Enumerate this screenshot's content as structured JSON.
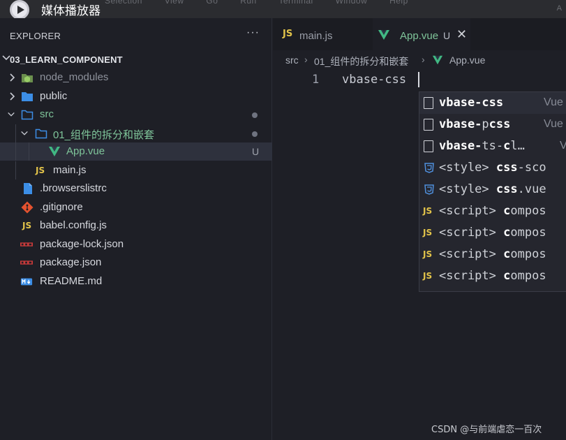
{
  "player": {
    "title": "媒体播放器",
    "ghost_menu": [
      "Selection",
      "View",
      "Go",
      "Run",
      "Terminal",
      "Window",
      "Help"
    ],
    "ghost_right": "A"
  },
  "explorer": {
    "title": "EXPLORER",
    "more": "···",
    "project": "03_LEARN_COMPONENT",
    "items": [
      {
        "label": "node_modules",
        "kind": "folder-node",
        "expanded": false,
        "status": ""
      },
      {
        "label": "public",
        "kind": "folder-blue",
        "expanded": false,
        "status": ""
      },
      {
        "label": "src",
        "kind": "folder-open",
        "expanded": true,
        "status": "modified-dot"
      },
      {
        "label": "01_组件的拆分和嵌套",
        "kind": "folder-open",
        "expanded": true,
        "status": "modified-dot"
      },
      {
        "label": "App.vue",
        "kind": "vue",
        "status": "U"
      },
      {
        "label": "main.js",
        "kind": "js",
        "status": ""
      },
      {
        "label": ".browserslistrc",
        "kind": "file-blue",
        "status": ""
      },
      {
        "label": ".gitignore",
        "kind": "git",
        "status": ""
      },
      {
        "label": "babel.config.js",
        "kind": "js",
        "status": ""
      },
      {
        "label": "package-lock.json",
        "kind": "npm",
        "status": ""
      },
      {
        "label": "package.json",
        "kind": "npm",
        "status": ""
      },
      {
        "label": "README.md",
        "kind": "markdown",
        "status": ""
      }
    ]
  },
  "tabs": [
    {
      "label": "main.js",
      "icon": "JS",
      "active": false
    },
    {
      "label": "App.vue",
      "badge": "U",
      "close": "✕",
      "active": true
    }
  ],
  "breadcrumb": [
    "src",
    "01_组件的拆分和嵌套",
    "App.vue"
  ],
  "editor": {
    "line_number": "1",
    "code": "vbase-css"
  },
  "suggestions": [
    {
      "pre": "",
      "match": "vbase-css",
      "post": "",
      "detail": "Vue",
      "icon": "snippet"
    },
    {
      "pre": "",
      "match": "vbase-",
      "mid": "p",
      "match2": "css",
      "detail": "Vue",
      "icon": "snippet"
    },
    {
      "pre": "",
      "match": "vbase-",
      "mid": "ts-",
      "match2": "c",
      "rest": "l…",
      "detail": "V",
      "icon": "snippet"
    },
    {
      "pre": "<style> ",
      "match": "css",
      "post": "-sco",
      "icon": "css"
    },
    {
      "pre": "<style> ",
      "match": "css",
      "post": ".vue",
      "icon": "css"
    },
    {
      "pre": "<script> ",
      "match": "c",
      "post": "ompos",
      "icon": "js"
    },
    {
      "pre": "<script> ",
      "match": "c",
      "post": "ompos",
      "icon": "js"
    },
    {
      "pre": "<script> ",
      "match": "c",
      "post": "ompos",
      "icon": "js"
    },
    {
      "pre": "<script> ",
      "match": "c",
      "post": "ompos",
      "icon": "js"
    }
  ],
  "watermark": "CSDN @与前端虐恋一百次",
  "colors": {
    "vue_green": "#41b883",
    "js_yellow": "#e3c44a",
    "folder_blue": "#3c8ee6",
    "css_blue": "#4f8fdc",
    "git_orange": "#e4522f",
    "npm_red": "#c73a3a"
  }
}
